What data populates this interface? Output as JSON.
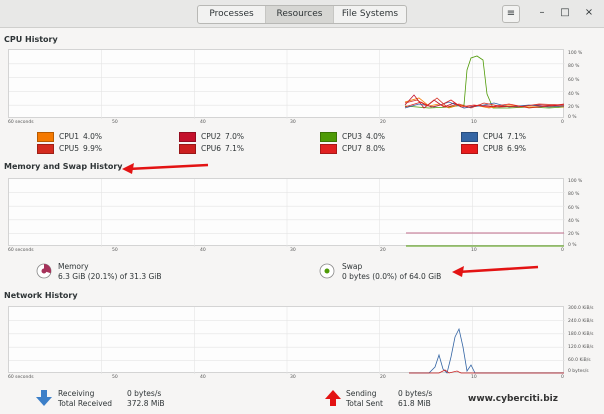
{
  "tabs": [
    "Processes",
    "Resources",
    "File Systems"
  ],
  "active_tab": "Resources",
  "window_buttons": [
    "≡",
    "–",
    "□",
    "×"
  ],
  "cpu": {
    "title": "CPU History",
    "cores": [
      {
        "label": "CPU1",
        "value": "4.0%",
        "color": "#f57900"
      },
      {
        "label": "CPU2",
        "value": "7.0%",
        "color": "#c4102b"
      },
      {
        "label": "CPU3",
        "value": "4.0%",
        "color": "#4e9a06"
      },
      {
        "label": "CPU4",
        "value": "7.1%",
        "color": "#3465a4"
      },
      {
        "label": "CPU5",
        "value": "9.9%",
        "color": "#d42b1e"
      },
      {
        "label": "CPU6",
        "value": "7.1%",
        "color": "#cc1f1f"
      },
      {
        "label": "CPU7",
        "value": "8.0%",
        "color": "#e02020"
      },
      {
        "label": "CPU8",
        "value": "6.9%",
        "color": "#e81c1c"
      }
    ]
  },
  "memory": {
    "title": "Memory and Swap History",
    "memory_label": "Memory",
    "memory_value": "6.3 GiB (20.1%) of 31.3 GiB",
    "swap_label": "Swap",
    "swap_value": "0 bytes (0.0%) of 64.0 GiB"
  },
  "network": {
    "title": "Network History",
    "receiving_label": "Receiving",
    "receiving_value": "0 bytes/s",
    "total_received_label": "Total Received",
    "total_received_value": "372.8 MiB",
    "sending_label": "Sending",
    "sending_value": "0 bytes/s",
    "total_sent_label": "Total Sent",
    "total_sent_value": "61.8 MiB"
  },
  "axis": {
    "x_ticks": [
      "60 seconds",
      "50",
      "40",
      "30",
      "20",
      "10",
      "0"
    ],
    "percent_ticks": [
      "100 %",
      "80 %",
      "60 %",
      "40 %",
      "20 %",
      "0 %"
    ],
    "net_ticks": [
      "300.0 KiB/s",
      "240.0 KiB/s",
      "180.0 KiB/s",
      "120.0 KiB/s",
      "60.0 KiB/s",
      "0 bytes/s"
    ]
  },
  "watermark": "www.cyberciti.biz"
}
